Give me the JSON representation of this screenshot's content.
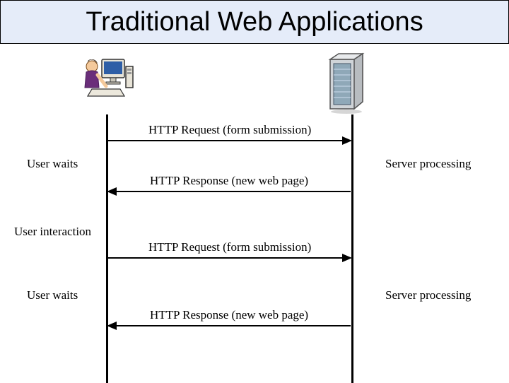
{
  "title": "Traditional Web Applications",
  "messages": {
    "req1": "HTTP Request (form submission)",
    "res1": "HTTP Response (new web page)",
    "req2": "HTTP Request (form submission)",
    "res2": "HTTP Response (new web page)"
  },
  "sides": {
    "user_waits1": "User waits",
    "user_interaction": "User interaction",
    "user_waits2": "User waits",
    "server_proc1": "Server processing",
    "server_proc2": "Server processing"
  },
  "actors": {
    "user": "user-at-computer",
    "server": "server-rack"
  }
}
